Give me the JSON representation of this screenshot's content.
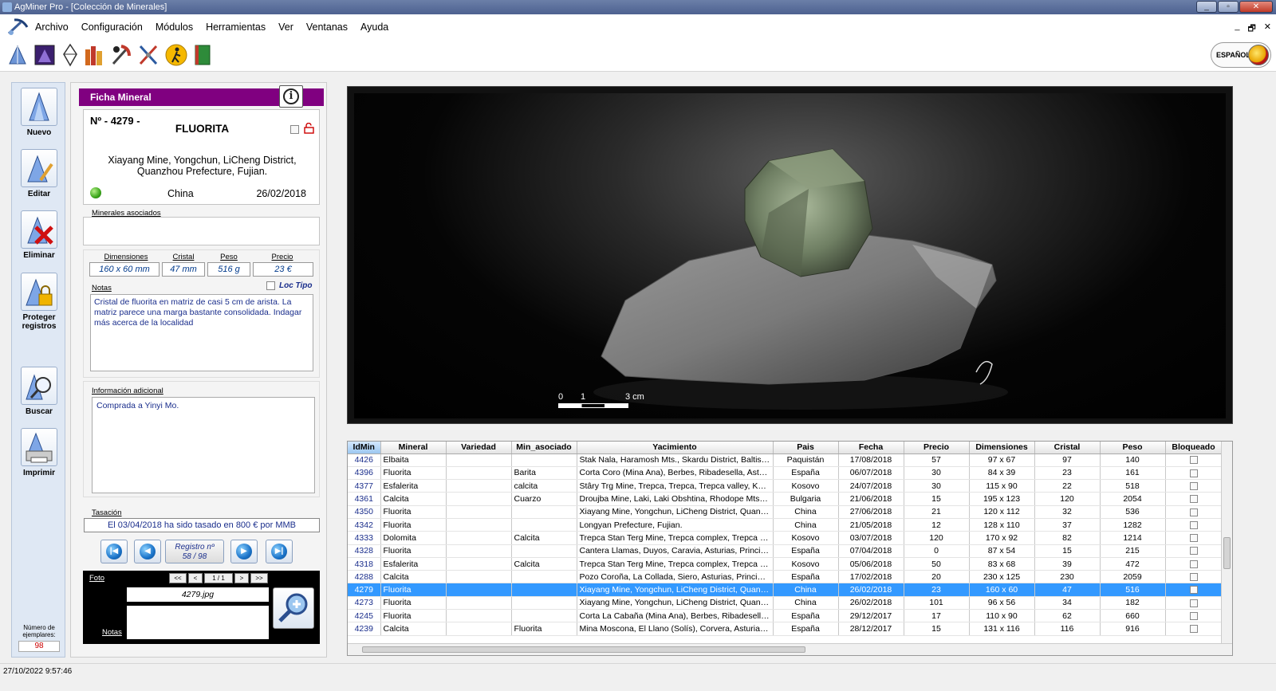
{
  "window": {
    "title": "AgMiner Pro - [Colección de Minerales]",
    "controls": [
      "_",
      "▫",
      "✕"
    ]
  },
  "menu": {
    "items": [
      "Archivo",
      "Configuración",
      "Módulos",
      "Herramientas",
      "Ver",
      "Ventanas",
      "Ayuda"
    ],
    "mdi_controls": [
      "_",
      "🗗",
      "✕"
    ]
  },
  "toolbar": {
    "language": "ESPAÑOL"
  },
  "sidebar": {
    "buttons": [
      {
        "label": "Nuevo"
      },
      {
        "label": "Editar"
      },
      {
        "label": "Eliminar"
      },
      {
        "label": "Proteger registros"
      },
      {
        "label": "Buscar"
      },
      {
        "label": "Imprimir"
      }
    ],
    "count_label": "Número de ejemplares:",
    "count": "98"
  },
  "ficha": {
    "header": "Ficha Mineral",
    "info_icon": "i",
    "number": "Nº - 4279 -",
    "mineral": "FLUORITA",
    "locality_line1": "Xiayang Mine, Yongchun, LiCheng District,",
    "locality_line2": "Quanzhou Prefecture, Fujian.",
    "country": "China",
    "date": "26/02/2018",
    "asociados_label": "Minerales asociados",
    "asociados": "",
    "dim_label": "Dimensiones",
    "cristal_label": "Cristal",
    "peso_label": "Peso",
    "precio_label": "Precio",
    "dimensiones": "160 x 60 mm",
    "cristal": "47 mm",
    "peso": "516 g",
    "precio": "23 €",
    "notas_label": "Notas",
    "loc_tipo_label": "Loc Tipo",
    "notas": "Cristal de fluorita en matriz de casi 5 cm de arista. La matriz parece una marga bastante consolidada. Indagar más acerca de la localidad",
    "info_adicional_label": "Información adicional",
    "info_adicional": "Comprada a Yinyi Mo.",
    "tasacion_label": "Tasación",
    "tasacion": "El 03/04/2018 ha sido tasado en 800 € por MMB",
    "registro_label": "Registro nº",
    "registro": "58 / 98",
    "foto_label": "Foto",
    "foto_page": "1 / 1",
    "foto_nav": [
      "<<",
      "<",
      ">",
      ">>"
    ],
    "foto_file": "4279.jpg",
    "foto_notas_label": "Notas"
  },
  "viewer": {
    "scale_0": "0",
    "scale_1": "1",
    "scale_3": "3 cm"
  },
  "grid": {
    "columns": [
      "IdMin",
      "Mineral",
      "Variedad",
      "Min_asociado",
      "Yacimiento",
      "Pais",
      "Fecha",
      "Precio",
      "Dimensiones",
      "Cristal",
      "Peso",
      "Bloqueado"
    ],
    "rows": [
      {
        "id": "4426",
        "mineral": "Elbaita",
        "variedad": "",
        "asociado": "",
        "yacimiento": "Stak Nala, Haramosh Mts., Skardu District, Baltistan...",
        "pais": "Paquistán",
        "fecha": "17/08/2018",
        "precio": "57",
        "dim": "97 x 67",
        "cristal": "97",
        "peso": "140"
      },
      {
        "id": "4396",
        "mineral": "Fluorita",
        "variedad": "",
        "asociado": "Barita",
        "yacimiento": "Corta Coro (Mina Ana), Berbes, Ribadesella, Asturia...",
        "pais": "España",
        "fecha": "06/07/2018",
        "precio": "30",
        "dim": "84 x 39",
        "cristal": "23",
        "peso": "161"
      },
      {
        "id": "4377",
        "mineral": "Esfalerita",
        "variedad": "",
        "asociado": "calcita",
        "yacimiento": "Stâry Trg Mine, Trepca, Trepca, Trepca valley, Kosov...",
        "pais": "Kosovo",
        "fecha": "24/07/2018",
        "precio": "30",
        "dim": "115 x 90",
        "cristal": "22",
        "peso": "518"
      },
      {
        "id": "4361",
        "mineral": "Calcita",
        "variedad": "",
        "asociado": "Cuarzo",
        "yacimiento": "Droujba Mine, Laki, Laki Obshtina, Rhodope Mts, Pl...",
        "pais": "Bulgaria",
        "fecha": "21/06/2018",
        "precio": "15",
        "dim": "195 x 123",
        "cristal": "120",
        "peso": "2054"
      },
      {
        "id": "4350",
        "mineral": "Fluorita",
        "variedad": "",
        "asociado": "",
        "yacimiento": "Xiayang Mine, Yongchun, LiCheng District, Quanzho...",
        "pais": "China",
        "fecha": "27/06/2018",
        "precio": "21",
        "dim": "120 x 112",
        "cristal": "32",
        "peso": "536"
      },
      {
        "id": "4342",
        "mineral": "Fluorita",
        "variedad": "",
        "asociado": "",
        "yacimiento": "Longyan Prefecture, Fujian.",
        "pais": "China",
        "fecha": "21/05/2018",
        "precio": "12",
        "dim": "128 x 110",
        "cristal": "37",
        "peso": "1282"
      },
      {
        "id": "4333",
        "mineral": "Dolomita",
        "variedad": "",
        "asociado": "Calcita",
        "yacimiento": "Trepca Stan Terg Mine, Trepca complex, Trepca vall...",
        "pais": "Kosovo",
        "fecha": "03/07/2018",
        "precio": "120",
        "dim": "170 x 92",
        "cristal": "82",
        "peso": "1214"
      },
      {
        "id": "4328",
        "mineral": "Fluorita",
        "variedad": "",
        "asociado": "",
        "yacimiento": "Cantera Llamas, Duyos, Caravia, Asturias, Principa...",
        "pais": "España",
        "fecha": "07/04/2018",
        "precio": "0",
        "dim": "87 x 54",
        "cristal": "15",
        "peso": "215"
      },
      {
        "id": "4318",
        "mineral": "Esfalerita",
        "variedad": "",
        "asociado": "Calcita",
        "yacimiento": "Trepca Stan Terg Mine, Trepca complex, Trepca vall...",
        "pais": "Kosovo",
        "fecha": "05/06/2018",
        "precio": "50",
        "dim": "83 x 68",
        "cristal": "39",
        "peso": "472"
      },
      {
        "id": "4288",
        "mineral": "Calcita",
        "variedad": "",
        "asociado": "",
        "yacimiento": "Pozo Coroña, La Collada, Siero, Asturias, Principad...",
        "pais": "España",
        "fecha": "17/02/2018",
        "precio": "20",
        "dim": "230 x 125",
        "cristal": "230",
        "peso": "2059"
      },
      {
        "id": "4279",
        "mineral": "Fluorita",
        "variedad": "",
        "asociado": "",
        "yacimiento": "Xiayang Mine, Yongchun, LiCheng District, Quanzho...",
        "pais": "China",
        "fecha": "26/02/2018",
        "precio": "23",
        "dim": "160 x 60",
        "cristal": "47",
        "peso": "516",
        "selected": true
      },
      {
        "id": "4273",
        "mineral": "Fluorita",
        "variedad": "",
        "asociado": "",
        "yacimiento": "Xiayang Mine, Yongchun, LiCheng District, Quanzho...",
        "pais": "China",
        "fecha": "26/02/2018",
        "precio": "101",
        "dim": "96 x 56",
        "cristal": "34",
        "peso": "182"
      },
      {
        "id": "4245",
        "mineral": "Fluorita",
        "variedad": "",
        "asociado": "",
        "yacimiento": "Corta La Cabaña (Mina Ana), Berbes, Ribadesella, ...",
        "pais": "España",
        "fecha": "29/12/2017",
        "precio": "17",
        "dim": "110 x 90",
        "cristal": "62",
        "peso": "660"
      },
      {
        "id": "4239",
        "mineral": "Calcita",
        "variedad": "",
        "asociado": "Fluorita",
        "yacimiento": "Mina Moscona, El Llano (Solís), Corvera, Asturias, P...",
        "pais": "España",
        "fecha": "28/12/2017",
        "precio": "15",
        "dim": "131 x 116",
        "cristal": "116",
        "peso": "916"
      }
    ]
  },
  "status": {
    "datetime": "27/10/2022 9:57:46"
  }
}
